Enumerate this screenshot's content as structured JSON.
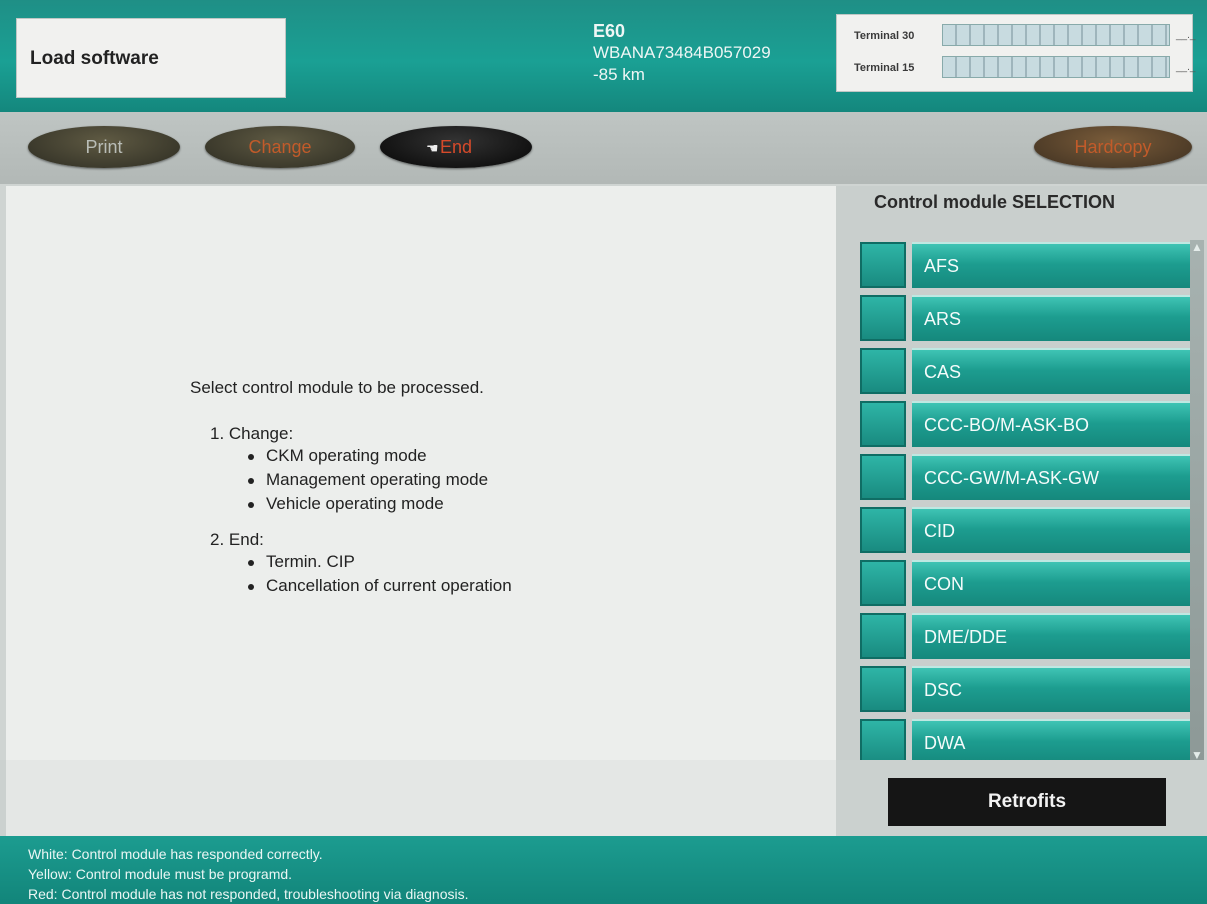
{
  "header": {
    "title": "Load software",
    "model": "E60",
    "vin": "WBANA73484B057029",
    "mileage": "-85 km",
    "terminals": [
      {
        "label": "Terminal 30",
        "value": "__._"
      },
      {
        "label": "Terminal 15",
        "value": "__._"
      }
    ]
  },
  "toolbar": {
    "print": "Print",
    "change": "Change",
    "end": "End",
    "hardcopy": "Hardcopy"
  },
  "content": {
    "heading": "Select control module to be processed.",
    "steps": [
      {
        "label": "1. Change:",
        "items": [
          "CKM operating mode",
          "Management operating mode",
          "Vehicle operating mode"
        ]
      },
      {
        "label": "2. End:",
        "items": [
          "Termin. CIP",
          "Cancellation of current operation"
        ]
      }
    ]
  },
  "panel": {
    "title": "Control module SELECTION",
    "modules": [
      "AFS",
      "ARS",
      "CAS",
      "CCC-BO/M-ASK-BO",
      "CCC-GW/M-ASK-GW",
      "CID",
      "CON",
      "DME/DDE",
      "DSC",
      "DWA"
    ],
    "retrofits": "Retrofits"
  },
  "footer": {
    "lines": [
      "White: Control module has responded correctly.",
      "Yellow: Control module must be programd.",
      "Red: Control module has not responded, troubleshooting via diagnosis."
    ]
  },
  "colors": {
    "accent": "#1aa094",
    "button_dark": "#3c3a2c",
    "end_text": "#d64a2a"
  }
}
